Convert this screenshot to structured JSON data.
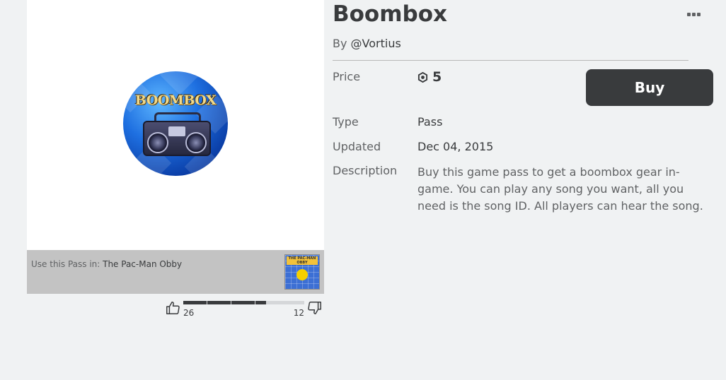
{
  "item": {
    "title": "Boombox",
    "creator_prefix": "By",
    "creator_name": "@Vortius",
    "image_text": "BOOMBOX"
  },
  "details": {
    "price_label": "Price",
    "price_value": "5",
    "type_label": "Type",
    "type_value": "Pass",
    "updated_label": "Updated",
    "updated_value": "Dec 04, 2015",
    "description_label": "Description",
    "description_value": "Buy this game pass to get a boombox gear in-game. You can play any song you want, all you need is the song ID. All players can hear the song."
  },
  "buy_button": {
    "label": "Buy"
  },
  "pass_bar": {
    "prefix": "Use this Pass in:",
    "game_name": "The Pac-Man Obby",
    "game_thumb_text": "THE PAC-MAN OBBY"
  },
  "votes": {
    "up": "26",
    "down": "12",
    "up_fraction": 0.684
  },
  "icons": {
    "menu": "more-icon",
    "currency": "robux-icon",
    "like": "thumbs-up-icon",
    "dislike": "thumbs-down-icon"
  },
  "colors": {
    "background": "#f0f2f3",
    "button": "#393b3d",
    "text": "#393b3d",
    "muted": "#606264"
  }
}
